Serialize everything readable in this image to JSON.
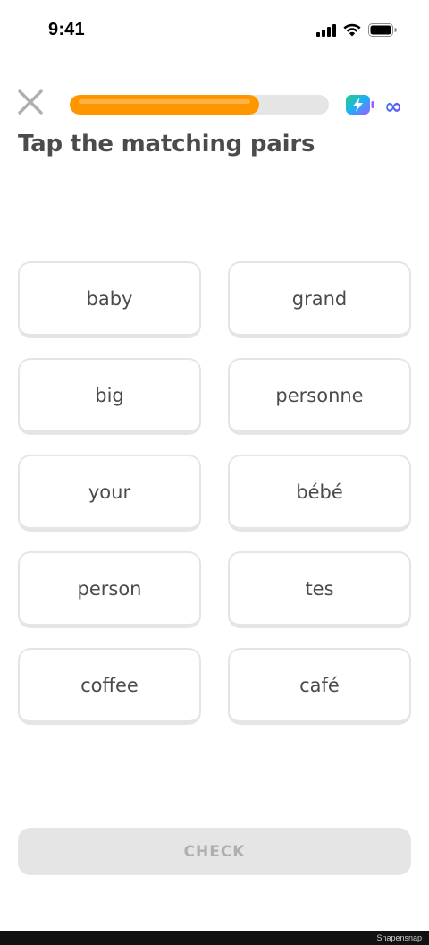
{
  "status_bar": {
    "time": "9:41",
    "icons": [
      "signal-icon",
      "wifi-icon",
      "battery-icon"
    ]
  },
  "header": {
    "close_icon": "close-icon",
    "progress": 0.73,
    "progress_color": "#ff9600",
    "energy_icon": "energy-battery-icon",
    "energy_value": "∞"
  },
  "title": "Tap the matching pairs",
  "tiles": {
    "left": [
      "baby",
      "big",
      "your",
      "person",
      "coffee"
    ],
    "right": [
      "grand",
      "personne",
      "bébé",
      "tes",
      "café"
    ]
  },
  "check_button": {
    "label": "CHECK",
    "enabled": false
  },
  "watermark": "Snapensnap",
  "colors": {
    "text": "#4b4b4b",
    "border": "#e5e5e5",
    "disabled_text": "#afafaf",
    "accent_blue": "#1cb0f6"
  }
}
